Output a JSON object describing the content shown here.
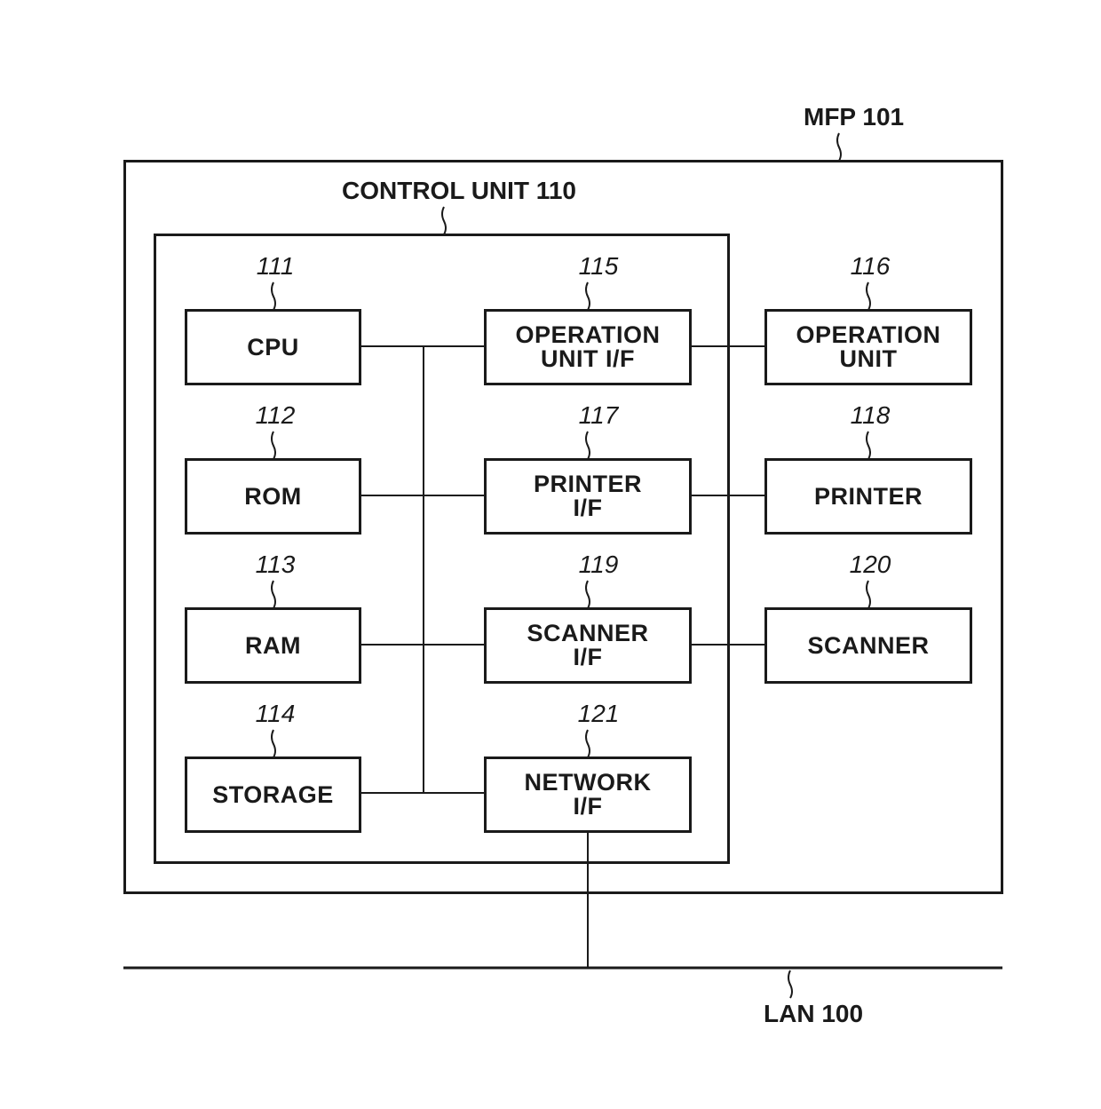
{
  "mfp": {
    "label": "MFP 101"
  },
  "control_unit": {
    "label": "CONTROL UNIT 110"
  },
  "lan": {
    "label": "LAN 100"
  },
  "blocks": {
    "cpu": {
      "ref": "111",
      "lines": [
        "CPU"
      ]
    },
    "rom": {
      "ref": "112",
      "lines": [
        "ROM"
      ]
    },
    "ram": {
      "ref": "113",
      "lines": [
        "RAM"
      ]
    },
    "storage": {
      "ref": "114",
      "lines": [
        "STORAGE"
      ]
    },
    "operation_unit_if": {
      "ref": "115",
      "lines": [
        "OPERATION",
        "UNIT I/F"
      ]
    },
    "operation_unit": {
      "ref": "116",
      "lines": [
        "OPERATION",
        "UNIT"
      ]
    },
    "printer_if": {
      "ref": "117",
      "lines": [
        "PRINTER",
        "I/F"
      ]
    },
    "printer": {
      "ref": "118",
      "lines": [
        "PRINTER"
      ]
    },
    "scanner_if": {
      "ref": "119",
      "lines": [
        "SCANNER",
        "I/F"
      ]
    },
    "scanner": {
      "ref": "120",
      "lines": [
        "SCANNER"
      ]
    },
    "network_if": {
      "ref": "121",
      "lines": [
        "NETWORK",
        "I/F"
      ]
    }
  }
}
